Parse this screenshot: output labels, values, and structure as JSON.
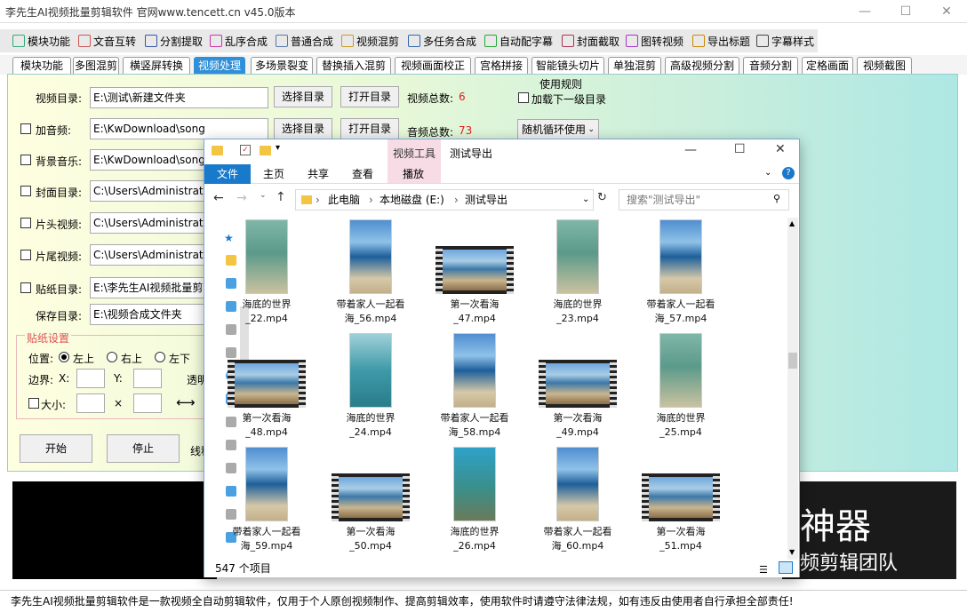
{
  "window": {
    "title": "李先生AI视频批量剪辑软件    官网www.tencett.cn    v45.0版本",
    "min": "—",
    "max": "☐",
    "close": "✕"
  },
  "toolbar": [
    "模块功能",
    "文音互转",
    "分割提取",
    "乱序合成",
    "普通合成",
    "视频混剪",
    "多任务合成",
    "自动配字幕",
    "封面截取",
    "图转视频",
    "导出标题",
    "字幕样式"
  ],
  "tabs": [
    "模块功能",
    "多图混剪",
    "横竖屏转换",
    "视频处理",
    "多场景裂变",
    "替换插入混剪",
    "视频画面校正",
    "宫格拼接",
    "智能镜头切片",
    "单独混剪",
    "高级视频分割",
    "音频分割",
    "定格画面",
    "视频截图"
  ],
  "form": {
    "video_dir_label": "视频目录:",
    "video_dir": "E:\\测试\\新建文件夹",
    "select_dir": "选择目录",
    "open_dir": "打开目录",
    "video_total_label": "视频总数:",
    "video_total": "6",
    "use_rule": "使用规则",
    "load_sub": "加载下一级目录",
    "add_audio": "加音频:",
    "audio_dir": "E:\\KwDownload\\song",
    "audio_total_label": "音频总数:",
    "audio_total": "73",
    "loop_mode": "随机循环使用",
    "bgm": "背景音乐:",
    "bgm_dir": "E:\\KwDownload\\song",
    "cover": "封面目录:",
    "cover_dir": "C:\\Users\\Administrator",
    "head": "片头视频:",
    "head_dir": "C:\\Users\\Administrator",
    "tail": "片尾视频:",
    "tail_dir": "C:\\Users\\Administrator",
    "sticker": "贴纸目录:",
    "sticker_dir": "E:\\李先生AI视频批量剪辑",
    "save": "保存目录:",
    "save_dir": "E:\\视频合成文件夹",
    "sticker_settings": "贴纸设置",
    "pos": "位置:",
    "pos_tl": "左上",
    "pos_tr": "右上",
    "pos_bl": "左下",
    "border": "边界:",
    "x": "X:",
    "y": "Y:",
    "opacity": "透明",
    "size": "大小:",
    "times": "×",
    "arrows": "⟷",
    "start": "开始",
    "stop": "停止",
    "thread": "线程"
  },
  "promo": {
    "line1": "神器",
    "line2": "频剪辑团队"
  },
  "status": "李先生AI视频批量剪辑软件是一款视频全自动剪辑软件，仅用于个人原创视频制作、提高剪辑效率，使用软件时请遵守法律法规，如有违反由使用者自行承担全部责任!",
  "explorer": {
    "ctx_group": "视频工具",
    "folder_title": "测试导出",
    "ribbon": [
      "文件",
      "主页",
      "共享",
      "查看",
      "播放"
    ],
    "path": [
      "此电脑",
      "本地磁盘 (E:)",
      "测试导出"
    ],
    "search_placeholder": "搜索\"测试导出\"",
    "count": "547 个项目",
    "files": [
      {
        "n1": "海底的世界",
        "n2": "_22.mp4",
        "k": "sea",
        "o": "v"
      },
      {
        "n1": "带着家人一起看",
        "n2": "海_56.mp4",
        "k": "beach",
        "o": "v"
      },
      {
        "n1": "第一次看海",
        "n2": "_47.mp4",
        "k": "shore",
        "o": "h"
      },
      {
        "n1": "海底的世界",
        "n2": "_23.mp4",
        "k": "sea",
        "o": "v"
      },
      {
        "n1": "带着家人一起看",
        "n2": "海_57.mp4",
        "k": "beach",
        "o": "v"
      },
      {
        "n1": "第一次看海",
        "n2": "_48.mp4",
        "k": "shore",
        "o": "h"
      },
      {
        "n1": "海底的世界",
        "n2": "_24.mp4",
        "k": "water",
        "o": "v"
      },
      {
        "n1": "带着家人一起看",
        "n2": "海_58.mp4",
        "k": "beach",
        "o": "v"
      },
      {
        "n1": "第一次看海",
        "n2": "_49.mp4",
        "k": "shore",
        "o": "h"
      },
      {
        "n1": "海底的世界",
        "n2": "_25.mp4",
        "k": "sea",
        "o": "v"
      },
      {
        "n1": "带着家人一起看",
        "n2": "海_59.mp4",
        "k": "beach",
        "o": "v"
      },
      {
        "n1": "第一次看海",
        "n2": "_50.mp4",
        "k": "shore",
        "o": "h"
      },
      {
        "n1": "海底的世界",
        "n2": "_26.mp4",
        "k": "reef",
        "o": "v"
      },
      {
        "n1": "带着家人一起看",
        "n2": "海_60.mp4",
        "k": "beach",
        "o": "v"
      },
      {
        "n1": "第一次看海",
        "n2": "_51.mp4",
        "k": "shore",
        "o": "h"
      }
    ]
  }
}
